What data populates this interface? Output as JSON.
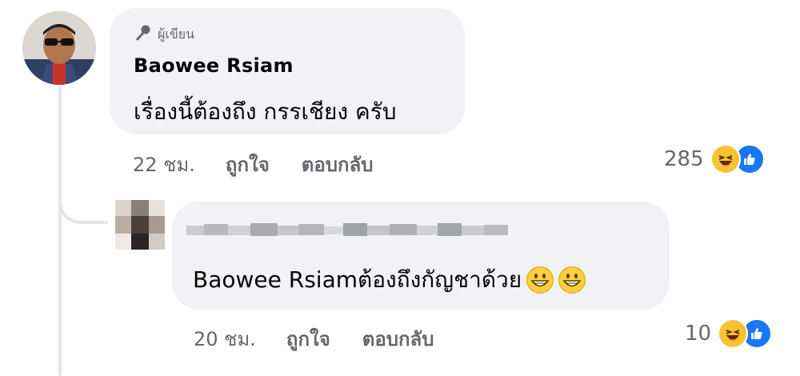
{
  "comment": {
    "author_badge": "ผู้เขียน",
    "author_name": "Baowee Rsiam",
    "text": "เรื่องนี้ต้องถึง กรรเชียง ครับ",
    "time": "22 ชม.",
    "like_label": "ถูกใจ",
    "reply_label": "ตอบกลับ",
    "reaction_count": "285",
    "reaction_icons": [
      "haha-icon",
      "like-icon"
    ]
  },
  "reply": {
    "text": "Baowee Rsiamต้องถึงกัญชาด้วย",
    "emojis": [
      "grinning-face-icon",
      "grinning-face-icon"
    ],
    "time": "20 ชม.",
    "like_label": "ถูกใจ",
    "reply_label": "ตอบกลับ",
    "reaction_count": "10",
    "reaction_icons": [
      "haha-icon",
      "like-icon"
    ]
  },
  "colors": {
    "bubble_bg": "#f0f2f5",
    "secondary_text": "#65676b",
    "like_blue": "#1877f2",
    "haha_yellow": "#f7c234"
  }
}
